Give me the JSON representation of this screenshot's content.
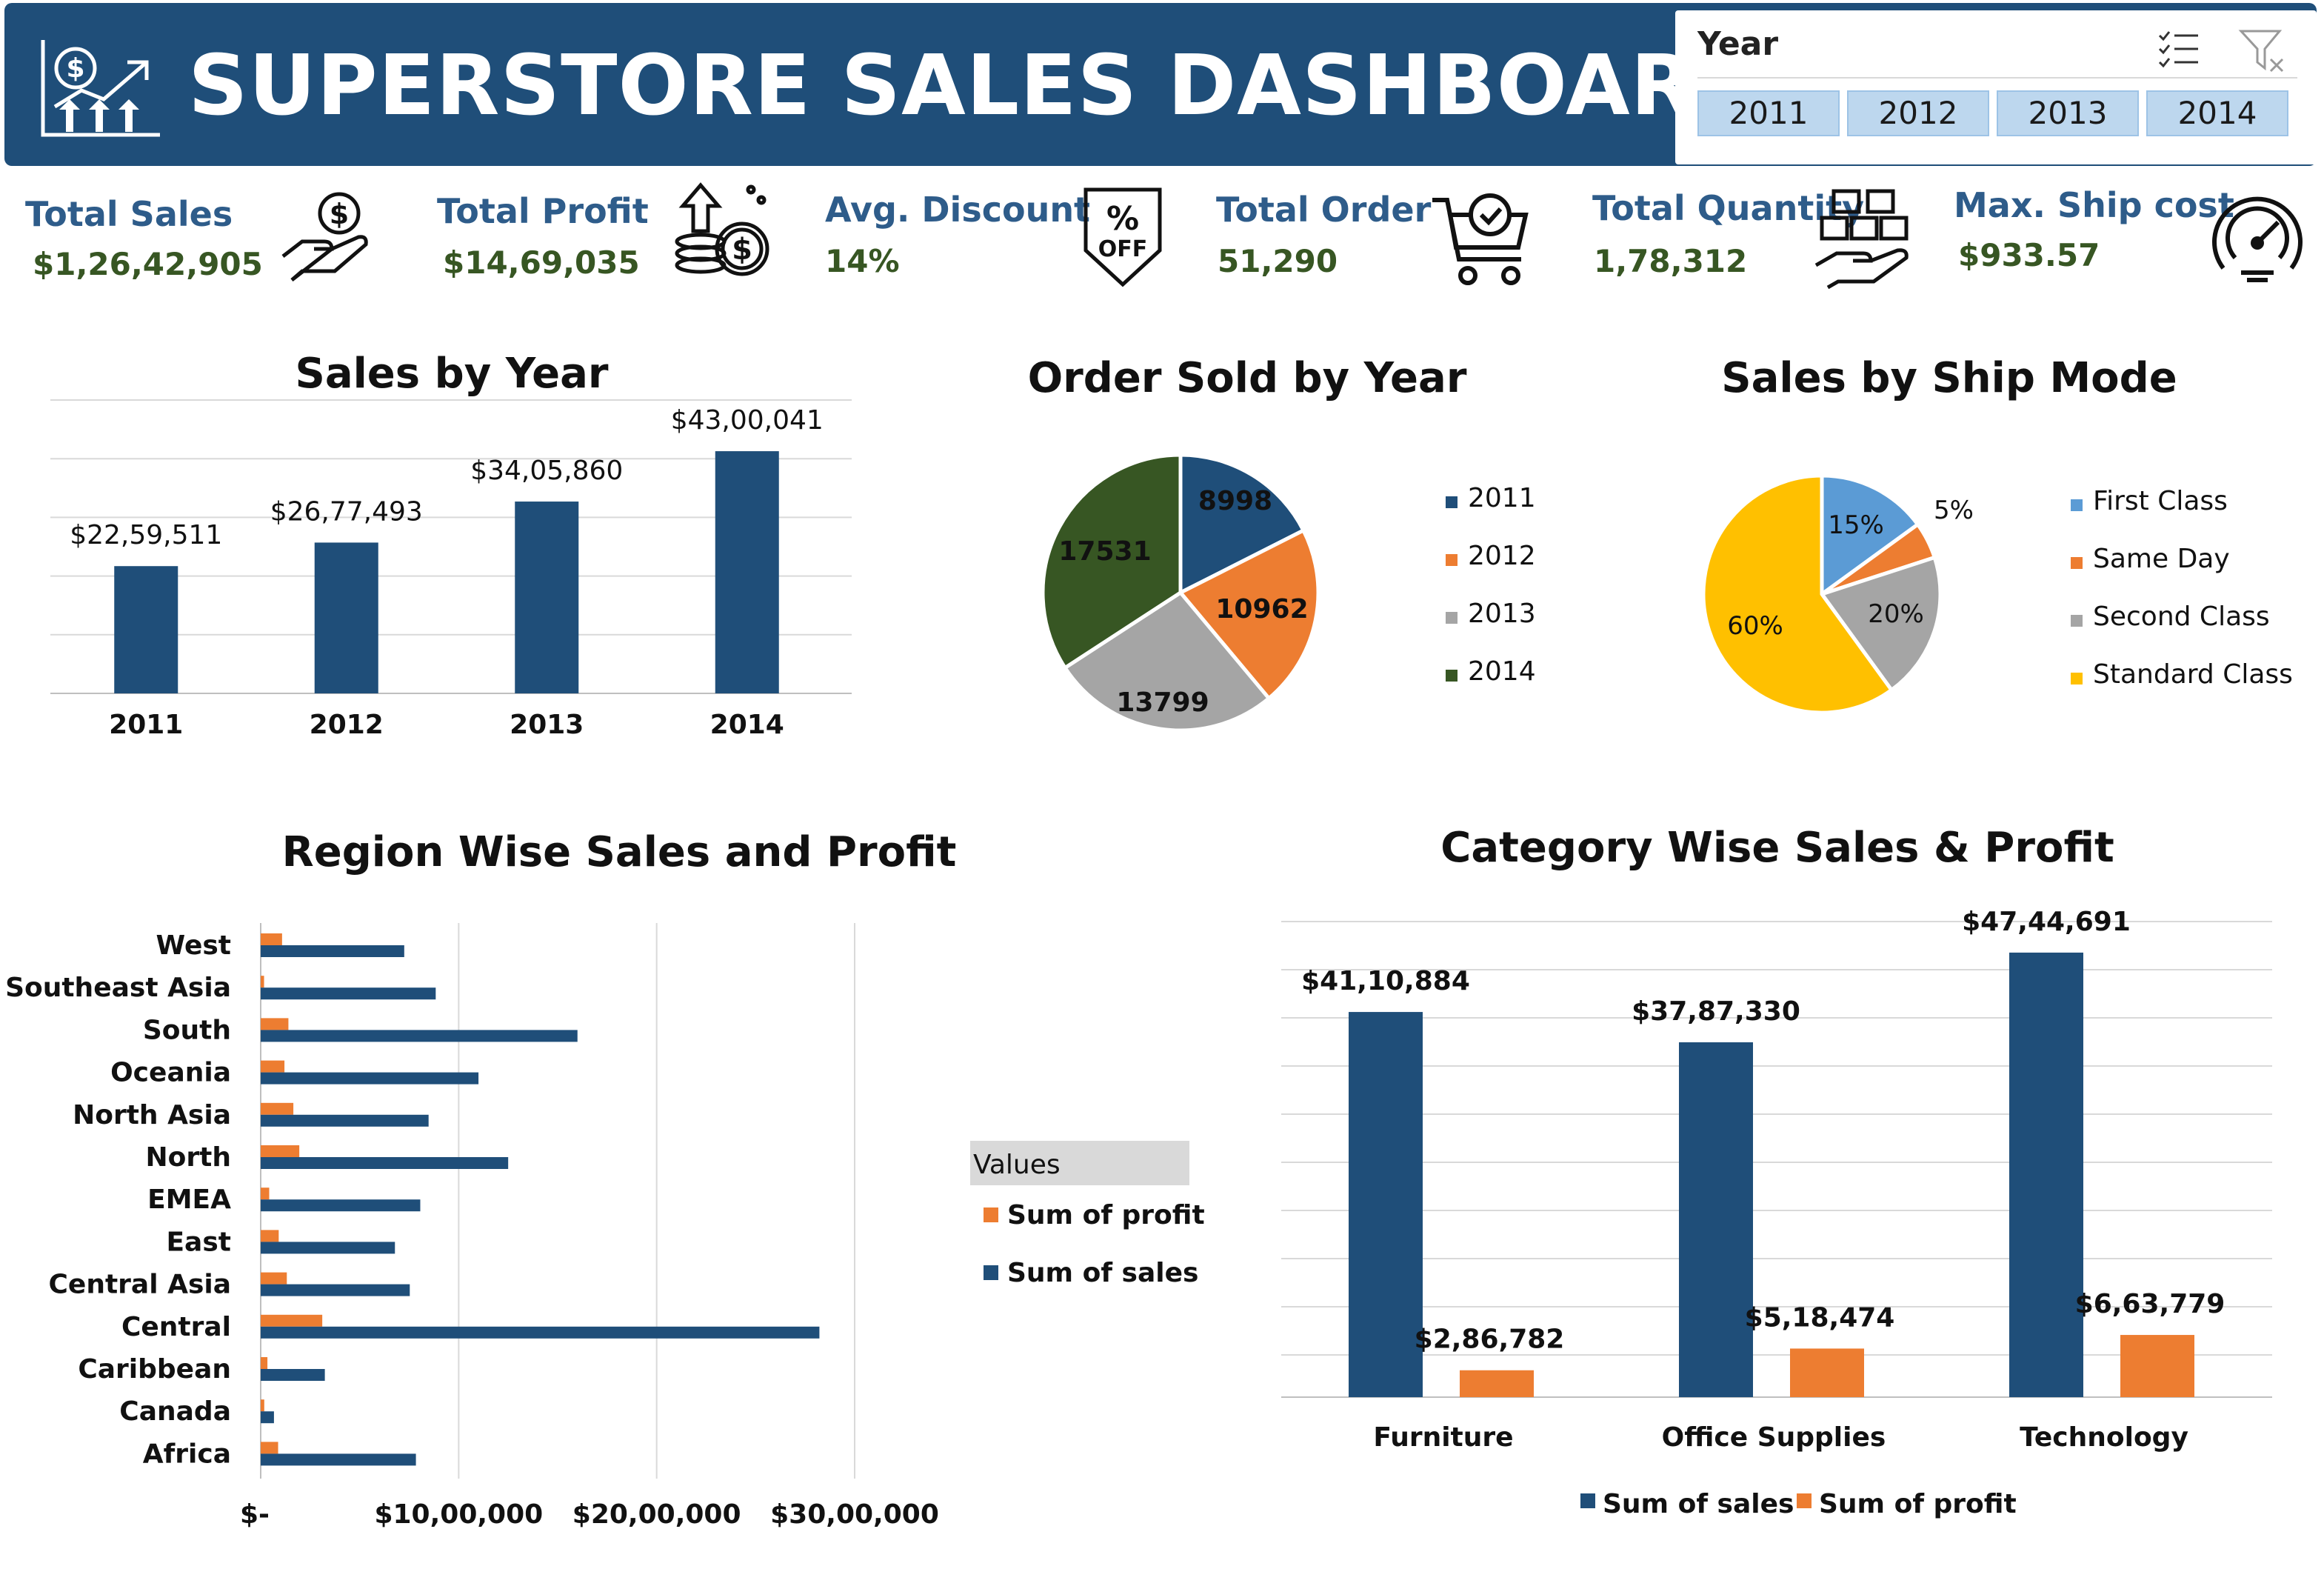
{
  "header": {
    "title": "SUPERSTORE SALES DASHBOARD",
    "slicer": {
      "title": "Year",
      "options": [
        "2011",
        "2012",
        "2013",
        "2014"
      ]
    }
  },
  "kpis": [
    {
      "label": "Total Sales",
      "value": "$1,26,42,905",
      "icon": "money-hand-icon"
    },
    {
      "label": "Total Profit",
      "value": "$14,69,035",
      "icon": "coins-growth-icon"
    },
    {
      "label": "Avg. Discount",
      "value": "14%",
      "icon": "discount-tag-icon"
    },
    {
      "label": "Total Order",
      "value": "51,290",
      "icon": "shopping-cart-icon"
    },
    {
      "label": "Total Quantity",
      "value": "1,78,312",
      "icon": "boxes-hand-icon"
    },
    {
      "label": "Max. Ship cost",
      "value": "$933.57",
      "icon": "speedometer-icon"
    }
  ],
  "colors": {
    "navy": "#1f4e79",
    "orange": "#ed7d31",
    "gray": "#a5a5a5",
    "green": "#375623",
    "blue": "#5b9bd5",
    "gold": "#ffc000",
    "kpi_label": "#2e5c8a",
    "kpi_value": "#375623"
  },
  "chart_data": [
    {
      "id": "sales_by_year",
      "type": "bar",
      "title": "Sales by Year",
      "categories": [
        "2011",
        "2012",
        "2013",
        "2014"
      ],
      "values": [
        2259511,
        2677493,
        3405860,
        4300041
      ],
      "labels": [
        "$22,59,511",
        "$26,77,493",
        "$34,05,860",
        "$43,00,041"
      ],
      "ylim": [
        0,
        5000000
      ],
      "grid": true
    },
    {
      "id": "orders_by_year",
      "type": "pie",
      "title": "Order Sold by Year",
      "categories": [
        "2011",
        "2012",
        "2013",
        "2014"
      ],
      "values": [
        8998,
        10962,
        13799,
        17531
      ],
      "labels": [
        "8998",
        "10962",
        "13799",
        "17531"
      ],
      "colors": [
        "#1f4e79",
        "#ed7d31",
        "#a5a5a5",
        "#375623"
      ],
      "legend": "right"
    },
    {
      "id": "sales_by_ship_mode",
      "type": "pie",
      "title": "Sales by Ship Mode",
      "categories": [
        "First Class",
        "Same Day",
        "Second Class",
        "Standard Class"
      ],
      "values": [
        15,
        5,
        20,
        60
      ],
      "labels": [
        "15%",
        "5%",
        "20%",
        "60%"
      ],
      "colors": [
        "#5b9bd5",
        "#ed7d31",
        "#a5a5a5",
        "#ffc000"
      ],
      "legend": "right"
    },
    {
      "id": "region_sales_profit",
      "type": "bar",
      "orientation": "horizontal",
      "title": "Region Wise Sales and Profit",
      "categories": [
        "West",
        "Southeast Asia",
        "South",
        "Oceania",
        "North Asia",
        "North",
        "EMEA",
        "East",
        "Central Asia",
        "Central",
        "Caribbean",
        "Canada",
        "Africa"
      ],
      "series": [
        {
          "name": "Sum of profit",
          "values": [
            108000,
            17000,
            140000,
            120000,
            165000,
            195000,
            43000,
            91000,
            132000,
            311000,
            34000,
            18000,
            88000
          ]
        },
        {
          "name": "Sum of sales",
          "values": [
            725000,
            884000,
            1600000,
            1100000,
            848000,
            1250000,
            806000,
            678000,
            753000,
            2822000,
            324000,
            67000,
            784000
          ]
        }
      ],
      "xlim": [
        0,
        3500000
      ],
      "xticks": [
        "$-",
        "$10,00,000",
        "$20,00,000",
        "$30,00,000"
      ],
      "legend_title": "Values",
      "legend": "right"
    },
    {
      "id": "category_sales_profit",
      "type": "bar",
      "title": "Category Wise Sales & Profit",
      "categories": [
        "Furniture",
        "Office Supplies",
        "Technology"
      ],
      "series": [
        {
          "name": "Sum of sales",
          "values": [
            4110884,
            3787330,
            4744691
          ],
          "labels": [
            "$41,10,884",
            "$37,87,330",
            "$47,44,691"
          ]
        },
        {
          "name": "Sum of profit",
          "values": [
            286782,
            518474,
            663779
          ],
          "labels": [
            "$2,86,782",
            "$5,18,474",
            "$6,63,779"
          ]
        }
      ],
      "ylim": [
        0,
        5000000
      ],
      "legend": "bottom"
    }
  ]
}
